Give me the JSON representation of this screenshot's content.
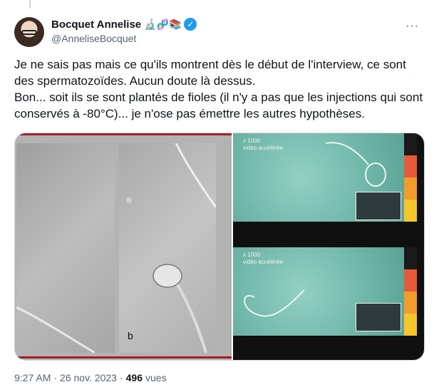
{
  "tweet": {
    "author_name": "Bocquet Annelise",
    "author_emojis": "🔬🧬📚",
    "handle": "@AnneliseBocquet",
    "paragraph1": "Je ne sais pas mais ce qu'ils montrent dès le début de l'interview, ce sont des spermatozoïdes. Aucun doute là dessus.",
    "paragraph2": "Bon... soit ils se sont plantés de fioles (il n'y a pas que les injections qui sont conservés à -80°C)... je n'ose pas émettre les autres hypothèses.",
    "more_label": "···",
    "panel_letter": "b",
    "video_label_1": "x 1000",
    "video_label_2": "vidéo accélérée",
    "time": "9:27 AM",
    "separator": "·",
    "date": "26 nov. 2023",
    "separator2": "·",
    "views_count": "496",
    "views_label": "vues"
  },
  "colors": {
    "verified_blue": "#1d9bf0",
    "accent_red": "#a61e2a"
  },
  "icons": {
    "verified": "verified-badge-icon",
    "more": "more-options-icon"
  }
}
